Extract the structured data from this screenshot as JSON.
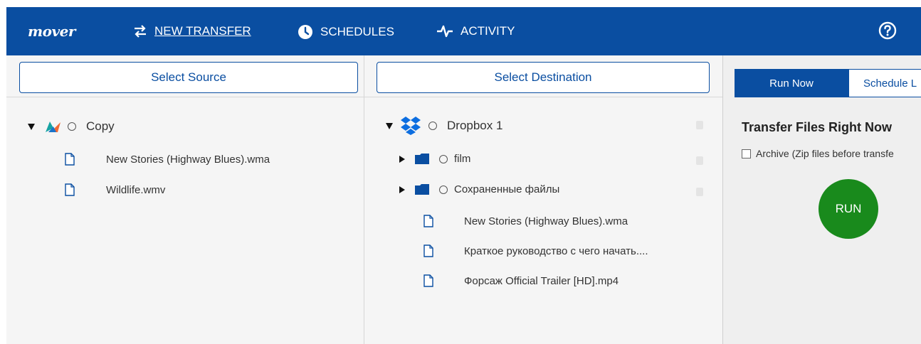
{
  "app": {
    "logo_text": "mover"
  },
  "nav": {
    "new_transfer": "NEW TRANSFER",
    "schedules": "SCHEDULES",
    "activity": "ACTIVITY"
  },
  "source": {
    "select_label": "Select Source",
    "root": {
      "name": "Copy"
    },
    "files": [
      {
        "name": "New Stories (Highway Blues).wma"
      },
      {
        "name": "Wildlife.wmv"
      }
    ]
  },
  "destination": {
    "select_label": "Select Destination",
    "root": {
      "name": "Dropbox 1"
    },
    "folders": [
      {
        "name": "film"
      },
      {
        "name": "Сохраненные файлы"
      }
    ],
    "files": [
      {
        "name": "New Stories (Highway Blues).wma"
      },
      {
        "name": "Краткое руководство с чего начать...."
      },
      {
        "name": "Форсаж Official Trailer [HD].mp4"
      }
    ]
  },
  "run_panel": {
    "tab_run_now": "Run Now",
    "tab_schedule": "Schedule L",
    "title": "Transfer Files Right Now",
    "archive_label": "Archive (Zip files before transfe",
    "run_button": "RUN"
  },
  "colors": {
    "brand": "#0a4ea1",
    "run_green": "#198a1c",
    "dropbox_blue": "#0d6ee0"
  }
}
